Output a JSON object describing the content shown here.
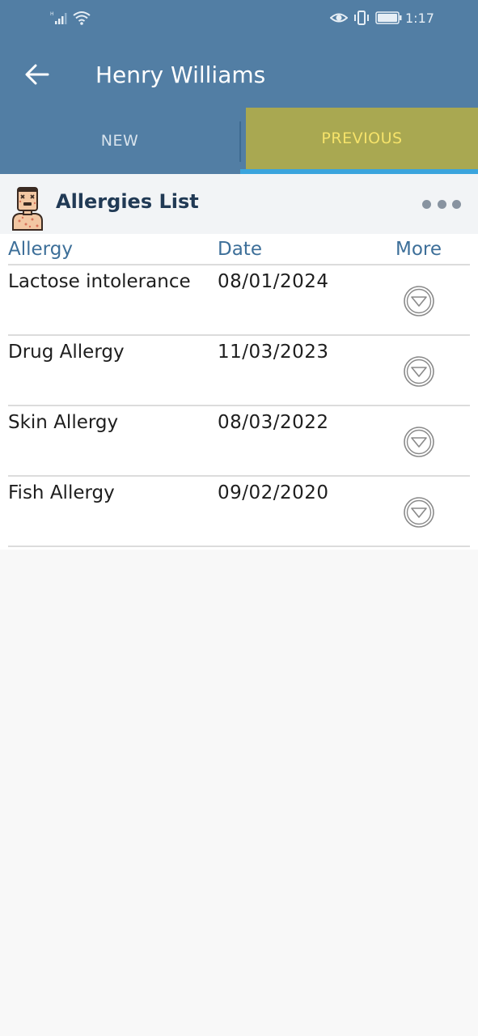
{
  "status_bar": {
    "time": "1:17",
    "icons": [
      "signal-icon",
      "wifi-icon",
      "eye-icon",
      "vibrate-icon",
      "battery-icon"
    ]
  },
  "header": {
    "back_icon": "arrow-left-icon",
    "title": "Henry Williams"
  },
  "tabs": [
    {
      "label": "NEW",
      "active": false
    },
    {
      "label": "PREVIOUS",
      "active": true
    }
  ],
  "section": {
    "icon": "allergy-person-icon",
    "title": "Allergies List",
    "menu_icon": "more-horizontal-icon"
  },
  "table": {
    "columns": [
      "Allergy",
      "Date",
      "More"
    ],
    "rows": [
      {
        "allergy": "Lactose intolerance",
        "date": "08/01/2024"
      },
      {
        "allergy": "Drug Allergy",
        "date": "11/03/2023"
      },
      {
        "allergy": "Skin Allergy",
        "date": "08/03/2022"
      },
      {
        "allergy": "Fish Allergy",
        "date": "09/02/2020"
      }
    ],
    "row_action_icon": "expand-down-icon"
  },
  "colors": {
    "appbar": "#527ea4",
    "active_tab_bg": "#a9a851",
    "active_tab_text": "#f6e36a",
    "tab_indicator": "#3aa4dd",
    "column_header": "#3d6f99",
    "section_title": "#213a55"
  }
}
